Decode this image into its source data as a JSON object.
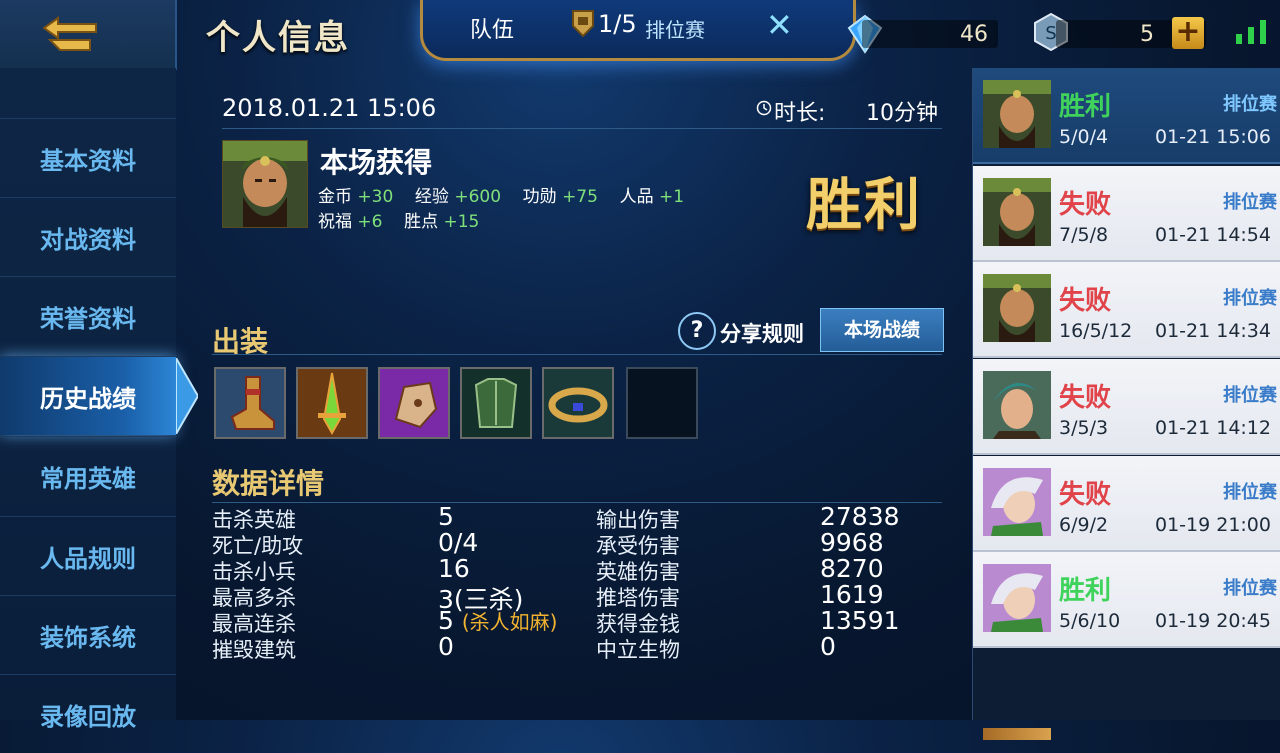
{
  "header": {
    "title": "个人信息",
    "team_label": "队伍",
    "rank_count": "1/5",
    "ranked_label": "排位赛",
    "close_icon": "close-icon",
    "currency_a": "46",
    "currency_b": "5"
  },
  "sidebar": {
    "items": [
      {
        "label": "基本资料"
      },
      {
        "label": "对战资料"
      },
      {
        "label": "荣誉资料"
      },
      {
        "label": "历史战绩"
      },
      {
        "label": "常用英雄"
      },
      {
        "label": "人品规则"
      },
      {
        "label": "装饰系统"
      },
      {
        "label": "录像回放"
      }
    ],
    "active_index": 3
  },
  "match": {
    "datetime": "2018.01.21 15:06",
    "duration_label": "时长:",
    "duration_value": "10分钟",
    "rewards_title": "本场获得",
    "rewards_row1": [
      {
        "label": "金币",
        "value": "+30"
      },
      {
        "label": "经验",
        "value": "+600"
      },
      {
        "label": "功勋",
        "value": "+75"
      },
      {
        "label": "人品",
        "value": "+1"
      }
    ],
    "rewards_row2": [
      {
        "label": "祝福",
        "value": "+6"
      },
      {
        "label": "胜点",
        "value": "+15"
      }
    ],
    "result_banner": "胜利"
  },
  "equipment": {
    "title": "出装",
    "share_rules": "分享规则",
    "match_stats_button": "本场战绩",
    "items": [
      "boots-item",
      "sword-item",
      "gauntlet-item",
      "armor-item",
      "ring-item",
      "empty-slot"
    ]
  },
  "details": {
    "title": "数据详情",
    "left": [
      {
        "label": "击杀英雄",
        "value": "5"
      },
      {
        "label": "死亡/助攻",
        "value": "0/4"
      },
      {
        "label": "击杀小兵",
        "value": "16"
      },
      {
        "label": "最高多杀",
        "value": "3(三杀)"
      },
      {
        "label": "最高连杀",
        "value": "5",
        "tag": "(杀人如麻)"
      },
      {
        "label": "摧毁建筑",
        "value": "0"
      }
    ],
    "right": [
      {
        "label": "输出伤害",
        "value": "27838"
      },
      {
        "label": "承受伤害",
        "value": "9968"
      },
      {
        "label": "英雄伤害",
        "value": "8270"
      },
      {
        "label": "推塔伤害",
        "value": "1619"
      },
      {
        "label": "获得金钱",
        "value": "13591"
      },
      {
        "label": "中立生物",
        "value": "0"
      }
    ]
  },
  "history": [
    {
      "result": "胜利",
      "mode": "排位赛",
      "kda": "5/0/4",
      "time": "01-21 15:06",
      "win": true,
      "hero": "guan-yu-avatar",
      "active": true
    },
    {
      "result": "失败",
      "mode": "排位赛",
      "kda": "7/5/8",
      "time": "01-21 14:54",
      "win": false,
      "hero": "guan-yu-avatar"
    },
    {
      "result": "失败",
      "mode": "排位赛",
      "kda": "16/5/12",
      "time": "01-21 14:34",
      "win": false,
      "hero": "guan-yu-avatar"
    },
    {
      "result": "失败",
      "mode": "排位赛",
      "kda": "3/5/3",
      "time": "01-21 14:12",
      "win": false,
      "hero": "teal-hair-hero-avatar"
    },
    {
      "result": "失败",
      "mode": "排位赛",
      "kda": "6/9/2",
      "time": "01-19 21:00",
      "win": false,
      "hero": "silver-hair-hero-avatar"
    },
    {
      "result": "胜利",
      "mode": "排位赛",
      "kda": "5/6/10",
      "time": "01-19 20:45",
      "win": true,
      "hero": "silver-hair-hero-avatar"
    }
  ],
  "colors": {
    "win": "#3fd35c",
    "loss": "#e0444a",
    "gold_accent": "#e8c872",
    "panel_blue": "#0b2347"
  }
}
